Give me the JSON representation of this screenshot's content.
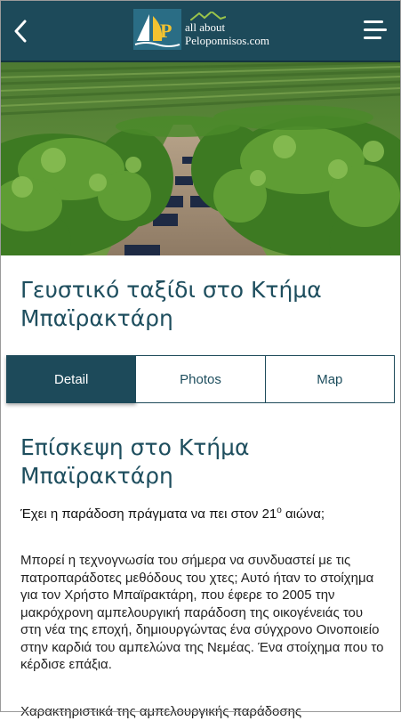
{
  "header": {
    "logo_line1": "all about",
    "logo_line2": "Peloponnisos.com",
    "bg_color": "#1d4a5a"
  },
  "hero": {
    "description_icon": "vineyard-photo"
  },
  "page_title": "Γευστικό ταξίδι στο Κτήμα Μπαϊρακτάρη",
  "tabs": [
    {
      "label": "Detail",
      "active": true
    },
    {
      "label": "Photos",
      "active": false
    },
    {
      "label": "Map",
      "active": false
    }
  ],
  "content": {
    "section_title": "Επίσκεψη στο Κτήμα Μπαϊρακτάρη",
    "lead_text": "Έχει η παράδοση πράγματα να πει στον 21",
    "lead_sup": "ο",
    "lead_end": " αιώνα;",
    "body": "Μπορεί η τεχνογνωσία του σήμερα να συνδυαστεί με τις πατροπαράδοτες μεθόδους του χτες; Αυτό ήταν το στοίχημα για τον Χρήστο Μπαϊρακτάρη, που έφερε το 2005 την μακρόχρονη αμπελουργική παράδοση της οικογένειάς του στη νέα της εποχή, δημιουργώντας ένα σύγχρονο Οινοποιείο στην καρδιά του αμπελώνα της Νεμέας. Ένα στοίχημα που το κέρδισε επάξια.",
    "cutoff_text": "Χαρακτηριστικά της αμπελουργικής παράδοσης"
  },
  "colors": {
    "accent": "#1d4a5a",
    "heading": "#1e4e5e"
  }
}
